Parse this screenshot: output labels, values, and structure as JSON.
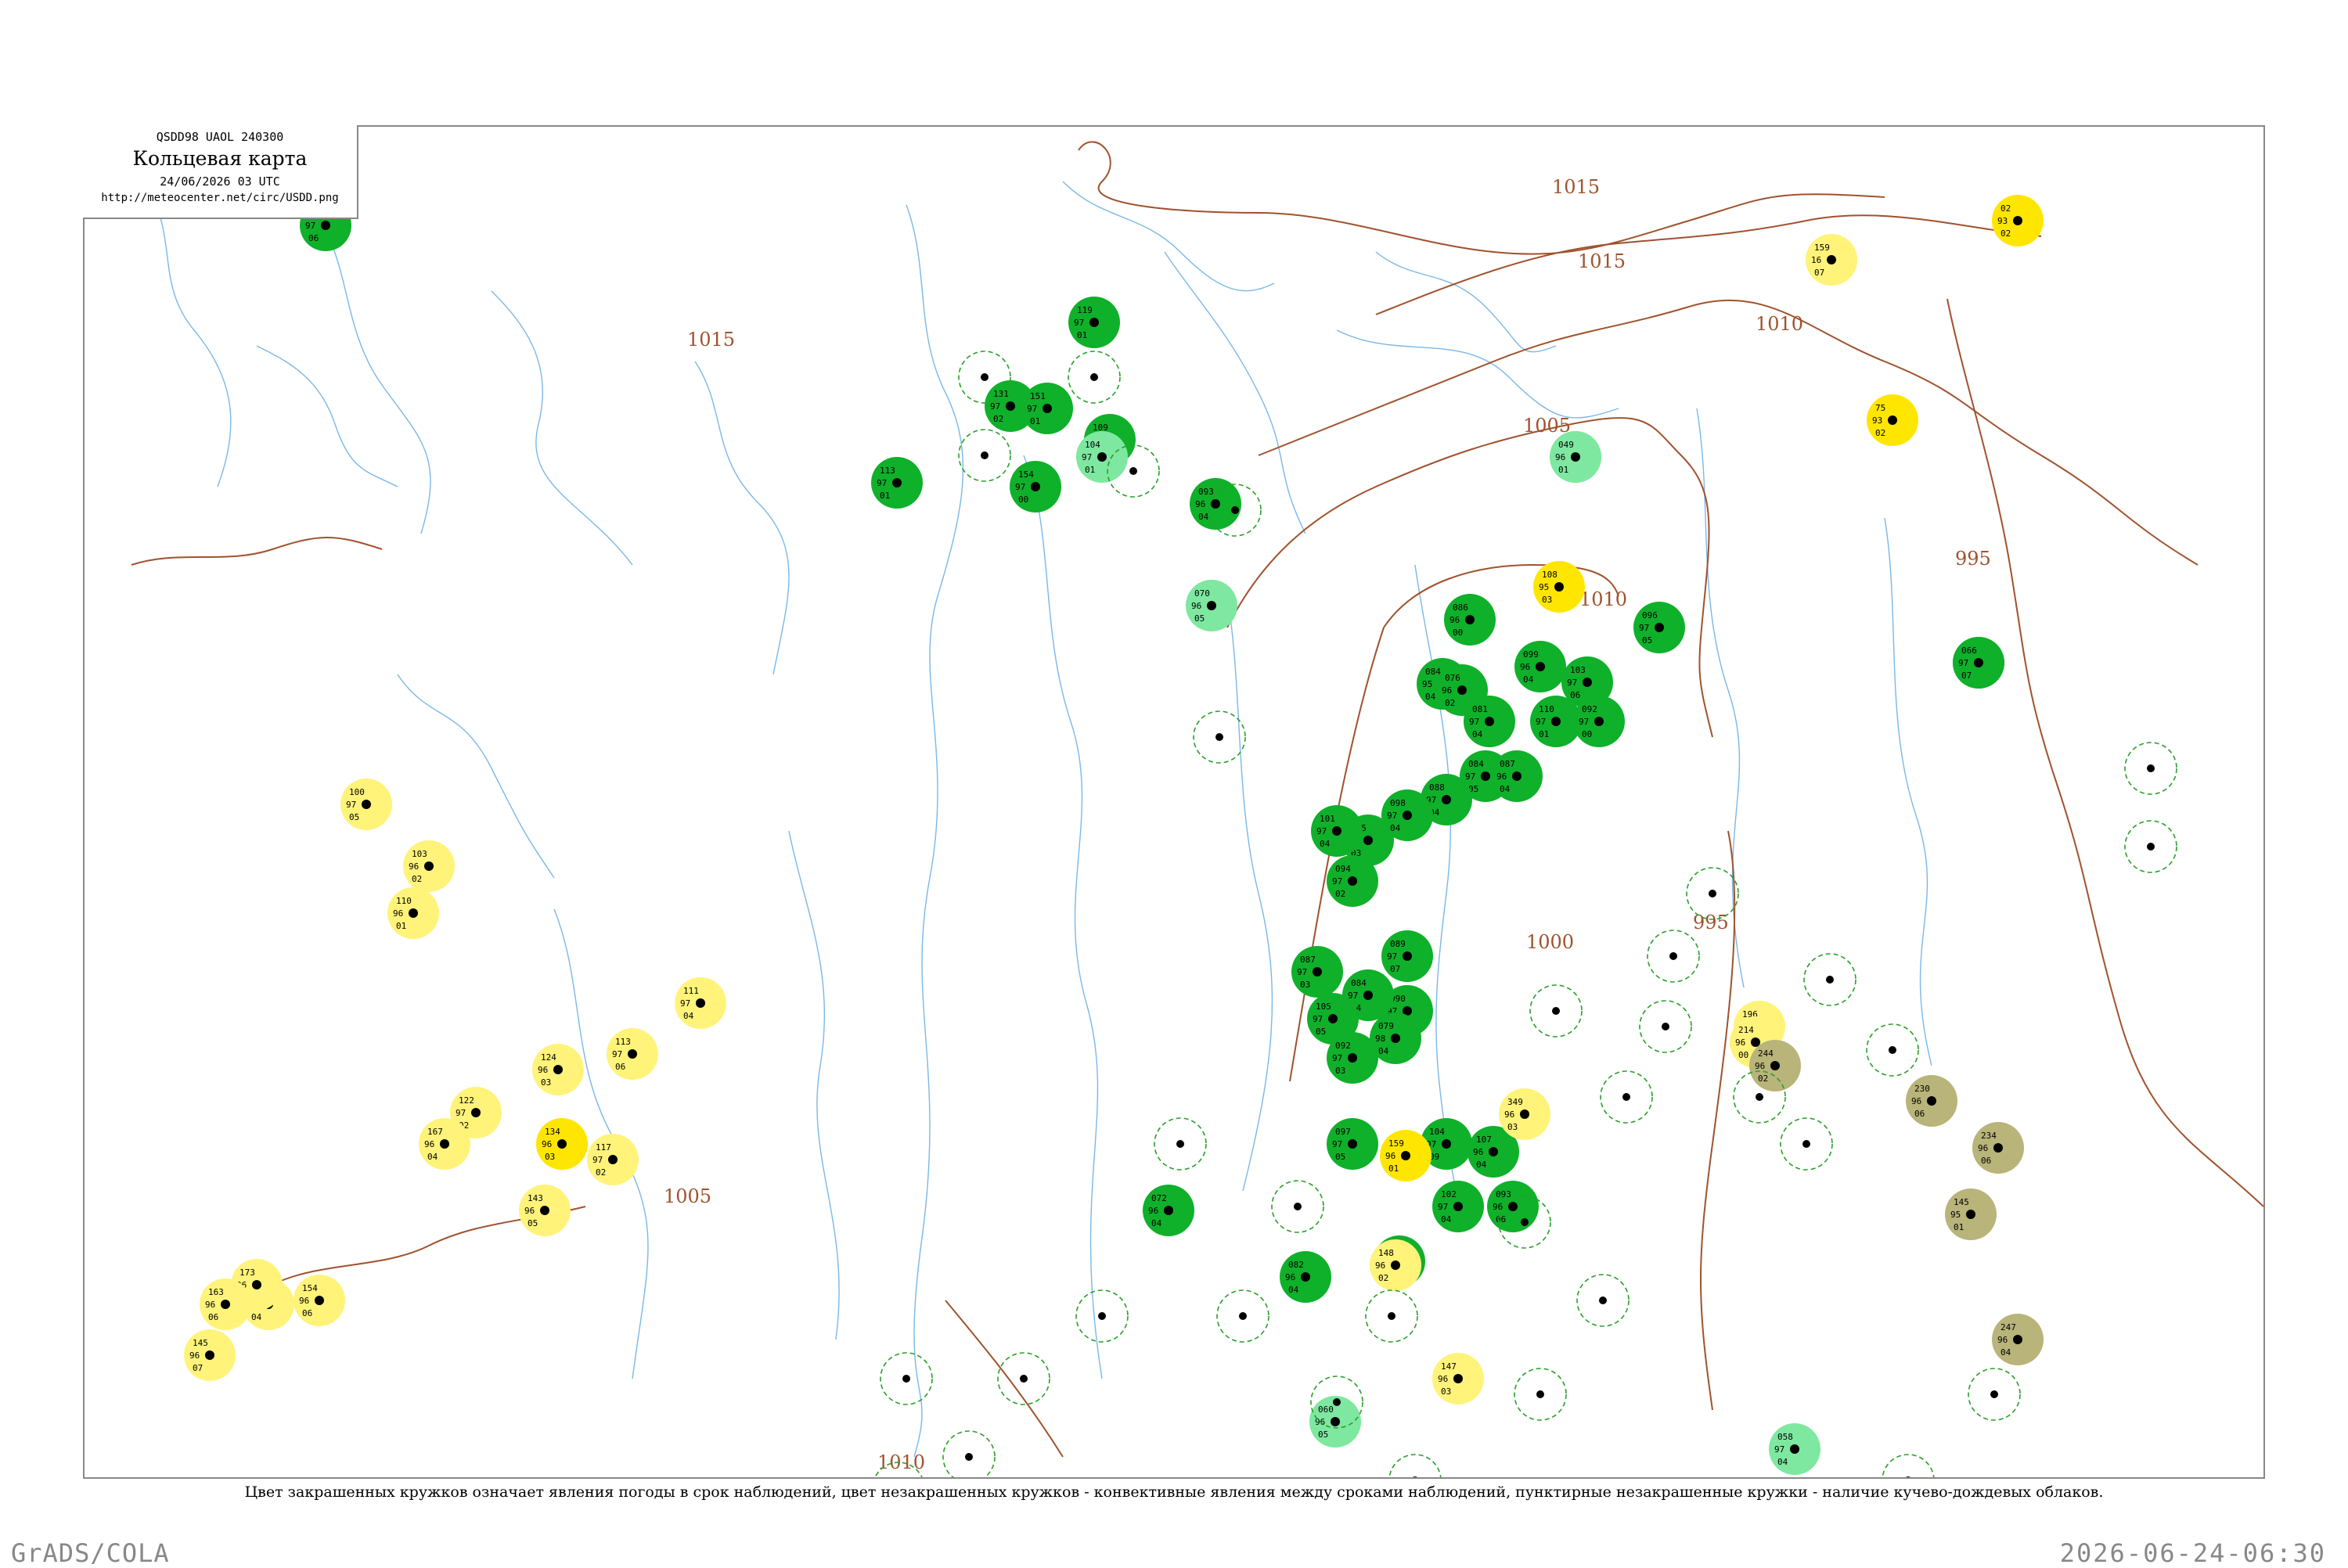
{
  "header": {
    "code": "QSDD98  UAOL  240300",
    "title": "Кольцевая карта",
    "datetime": "24/06/2026 03 UTC",
    "url": "http://meteocenter.net/circ/USDD.png"
  },
  "legend_note": "Цвет закрашенных кружков означает явления погоды в срок наблюдений, цвет незакрашенных кружков - конвективные явления между сроками наблюдений, пунктирные незакрашенные кружки - наличие кучево-дождевых облаков.",
  "footer": {
    "left": "GrADS/COLA",
    "right": "2026-06-24-06:30"
  },
  "colors": {
    "rain": "#0fb02a",
    "light_rain": "#7ee8a0",
    "haze": "#fff37a",
    "fog": "#ffe600",
    "dust": "#b8b47a",
    "thunder_ring": "#2aa02a",
    "isobar": "#a0522d",
    "river": "#7ab8e8",
    "frame": "#888888"
  },
  "isobar_labels": [
    "1015",
    "1015",
    "1010",
    "1005",
    "1010",
    "1000",
    "995",
    "995",
    "1010",
    "1015",
    "1005"
  ],
  "stations": [
    {
      "t": "121",
      "p": "97",
      "d": "06",
      "fill": "rain"
    },
    {
      "t": "113",
      "p": "97",
      "d": "01",
      "fill": "rain"
    },
    {
      "t": "131",
      "p": "97",
      "d": "02",
      "fill": "rain"
    },
    {
      "t": "119",
      "p": "97",
      "d": "01",
      "fill": "rain"
    },
    {
      "t": "109",
      "p": "96",
      "d": "00",
      "fill": "rain"
    },
    {
      "t": "151",
      "p": "97",
      "d": "01",
      "fill": "rain"
    },
    {
      "t": "154",
      "p": "97",
      "d": "00",
      "fill": "rain"
    },
    {
      "t": "093",
      "p": "96",
      "d": "04",
      "fill": "rain"
    },
    {
      "t": "095",
      "p": "97",
      "d": "03",
      "fill": "rain"
    },
    {
      "t": "086",
      "p": "96",
      "d": "00",
      "fill": "rain"
    },
    {
      "t": "084",
      "p": "95",
      "d": "04",
      "fill": "rain"
    },
    {
      "t": "076",
      "p": "96",
      "d": "02",
      "fill": "rain"
    },
    {
      "t": "081",
      "p": "97",
      "d": "04",
      "fill": "rain"
    },
    {
      "t": "099",
      "p": "96",
      "d": "04",
      "fill": "rain"
    },
    {
      "t": "103",
      "p": "97",
      "d": "06",
      "fill": "rain"
    },
    {
      "t": "084",
      "p": "97",
      "d": "05",
      "fill": "rain"
    },
    {
      "t": "087",
      "p": "96",
      "d": "04",
      "fill": "rain"
    },
    {
      "t": "110",
      "p": "97",
      "d": "01",
      "fill": "rain"
    },
    {
      "t": "092",
      "p": "97",
      "d": "00",
      "fill": "rain"
    },
    {
      "t": "088",
      "p": "97",
      "d": "04",
      "fill": "rain"
    },
    {
      "t": "098",
      "p": "97",
      "d": "04",
      "fill": "rain"
    },
    {
      "t": "101",
      "p": "97",
      "d": "04",
      "fill": "rain"
    },
    {
      "t": "094",
      "p": "97",
      "d": "02",
      "fill": "rain"
    },
    {
      "t": "087",
      "p": "97",
      "d": "03",
      "fill": "rain"
    },
    {
      "t": "089",
      "p": "97",
      "d": "07",
      "fill": "rain"
    },
    {
      "t": "090",
      "p": "97",
      "d": "07",
      "fill": "rain"
    },
    {
      "t": "084",
      "p": "97",
      "d": "04",
      "fill": "rain"
    },
    {
      "t": "105",
      "p": "97",
      "d": "05",
      "fill": "rain"
    },
    {
      "t": "092",
      "p": "97",
      "d": "03",
      "fill": "rain"
    },
    {
      "t": "079",
      "p": "98",
      "d": "04",
      "fill": "rain"
    },
    {
      "t": "097",
      "p": "97",
      "d": "05",
      "fill": "rain"
    },
    {
      "t": "104",
      "p": "97",
      "d": "09",
      "fill": "rain"
    },
    {
      "t": "107",
      "p": "96",
      "d": "04",
      "fill": "rain"
    },
    {
      "t": "102",
      "p": "97",
      "d": "04",
      "fill": "rain"
    },
    {
      "t": "093",
      "p": "96",
      "d": "06",
      "fill": "rain"
    },
    {
      "t": "096",
      "p": "97",
      "d": "05",
      "fill": "rain"
    },
    {
      "t": "103",
      "p": "97",
      "d": "04",
      "fill": "rain"
    },
    {
      "t": "091",
      "p": "97",
      "d": "05",
      "fill": "rain"
    },
    {
      "t": "066",
      "p": "97",
      "d": "07",
      "fill": "rain"
    },
    {
      "t": "072",
      "p": "96",
      "d": "04",
      "fill": "rain"
    },
    {
      "t": "082",
      "p": "96",
      "d": "04",
      "fill": "rain"
    },
    {
      "t": "060",
      "p": "96",
      "d": "05",
      "fill": "light_rain"
    },
    {
      "t": "070",
      "p": "96",
      "d": "05",
      "fill": "light_rain"
    },
    {
      "t": "104",
      "p": "97",
      "d": "01",
      "fill": "light_rain"
    },
    {
      "t": "042",
      "p": "96",
      "d": "01",
      "fill": "light_rain"
    },
    {
      "t": "049",
      "p": "96",
      "d": "01",
      "fill": "light_rain"
    },
    {
      "t": "058",
      "p": "97",
      "d": "04",
      "fill": "light_rain"
    },
    {
      "t": "100",
      "p": "97",
      "d": "05",
      "fill": "haze"
    },
    {
      "t": "103",
      "p": "96",
      "d": "02",
      "fill": "haze"
    },
    {
      "t": "110",
      "p": "96",
      "d": "01",
      "fill": "haze"
    },
    {
      "t": "111",
      "p": "97",
      "d": "04",
      "fill": "haze"
    },
    {
      "t": "113",
      "p": "97",
      "d": "06",
      "fill": "haze"
    },
    {
      "t": "117",
      "p": "97",
      "d": "02",
      "fill": "haze"
    },
    {
      "t": "122",
      "p": "97",
      "d": "02",
      "fill": "haze"
    },
    {
      "t": "124",
      "p": "96",
      "d": "03",
      "fill": "haze"
    },
    {
      "t": "143",
      "p": "96",
      "d": "05",
      "fill": "haze"
    },
    {
      "t": "167",
      "p": "96",
      "d": "04",
      "fill": "haze"
    },
    {
      "t": "168",
      "p": "96",
      "d": "04",
      "fill": "haze"
    },
    {
      "t": "173",
      "p": "96",
      "d": "05",
      "fill": "haze"
    },
    {
      "t": "163",
      "p": "96",
      "d": "06",
      "fill": "haze"
    },
    {
      "t": "145",
      "p": "96",
      "d": "07",
      "fill": "haze"
    },
    {
      "t": "154",
      "p": "96",
      "d": "06",
      "fill": "haze"
    },
    {
      "t": "196",
      "p": "96",
      "d": "04",
      "fill": "haze"
    },
    {
      "t": "214",
      "p": "96",
      "d": "00",
      "fill": "haze"
    },
    {
      "t": "349",
      "p": "96",
      "d": "03",
      "fill": "haze"
    },
    {
      "t": "148",
      "p": "96",
      "d": "02",
      "fill": "haze"
    },
    {
      "t": "147",
      "p": "96",
      "d": "03",
      "fill": "haze"
    },
    {
      "t": "07",
      "p": "17",
      "d": "06",
      "fill": "haze"
    },
    {
      "t": "159",
      "p": "16",
      "d": "07",
      "fill": "haze"
    },
    {
      "t": "02",
      "p": "93",
      "d": "02",
      "fill": "fog"
    },
    {
      "t": "75",
      "p": "93",
      "d": "02",
      "fill": "fog"
    },
    {
      "t": "108",
      "p": "95",
      "d": "03",
      "fill": "fog"
    },
    {
      "t": "159",
      "p": "96",
      "d": "01",
      "fill": "fog"
    },
    {
      "t": "134",
      "p": "96",
      "d": "03",
      "fill": "fog"
    },
    {
      "t": "244",
      "p": "96",
      "d": "02",
      "fill": "dust"
    },
    {
      "t": "230",
      "p": "96",
      "d": "06",
      "fill": "dust"
    },
    {
      "t": "234",
      "p": "96",
      "d": "06",
      "fill": "dust"
    },
    {
      "t": "145",
      "p": "95",
      "d": "01",
      "fill": "dust"
    },
    {
      "t": "247",
      "p": "96",
      "d": "04",
      "fill": "dust"
    }
  ]
}
